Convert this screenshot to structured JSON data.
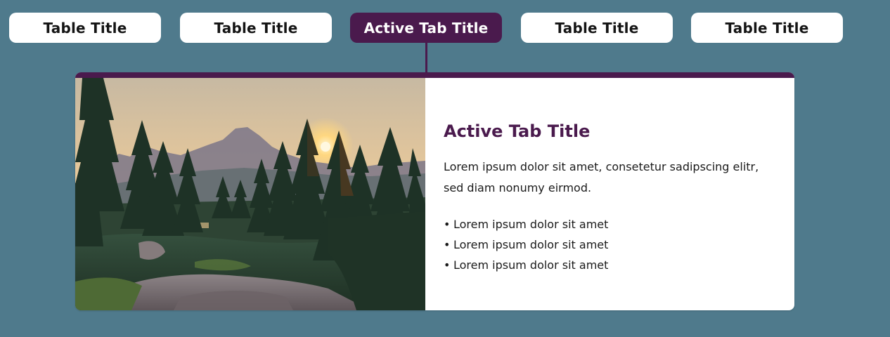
{
  "tabs": [
    {
      "label": "Table Title",
      "active": false
    },
    {
      "label": "Table Title",
      "active": false
    },
    {
      "label": "Active Tab Title",
      "active": true
    },
    {
      "label": "Table Title",
      "active": false
    },
    {
      "label": "Table Title",
      "active": false
    }
  ],
  "panel": {
    "title": "Active Tab Title",
    "description": "Lorem ipsum dolor sit amet, consetetur sadipscing elitr, sed diam nonumy eirmod.",
    "bullets": [
      "Lorem ipsum dolor sit amet",
      "Lorem ipsum dolor sit amet",
      "Lorem ipsum dolor sit amet"
    ],
    "bullet_glyph": "•",
    "image_icon": "mountain-forest-sunset-photo"
  },
  "colors": {
    "background": "#4f7a8c",
    "accent": "#4a1a4d",
    "tab_background": "#ffffff",
    "tab_text": "#141414",
    "active_tab_text": "#ffffff",
    "body_text": "#1a1a1a"
  }
}
